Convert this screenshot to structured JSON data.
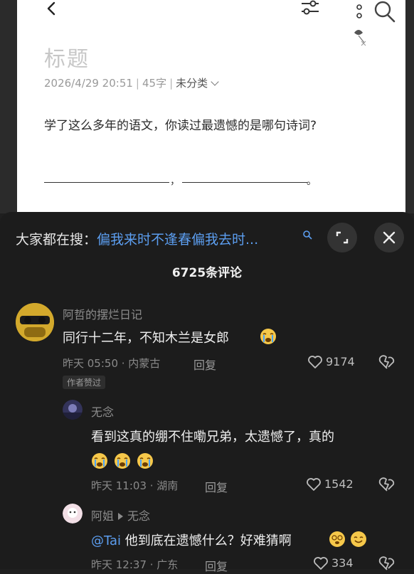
{
  "note": {
    "title": "标题",
    "date": "2026/4/29 20:51",
    "word_count": "45字",
    "category": "未分类",
    "question": "学了这么多年的语文，你读过最遗憾的是哪句诗词?",
    "comma": "，",
    "period": "。"
  },
  "comments_panel": {
    "search_label": "大家都在搜：",
    "search_query": "偏我来时不逢春偏我去时...",
    "count_text": "6725条评论"
  },
  "comments": [
    {
      "user": "阿哲的摆烂日记",
      "text": "同行十二年，不知木兰是女郎",
      "meta": "昨天 05:50 · 内蒙古",
      "reply": "回复",
      "likes": "9174",
      "badge": "作者赞过"
    },
    {
      "user": "无念",
      "text": "看到这真的绷不住嘞兄弟，太遗憾了，真的",
      "meta": "昨天 11:03 · 湖南",
      "reply": "回复",
      "likes": "1542"
    },
    {
      "user": "阿姐",
      "reply_to": "无念",
      "mention": "@Tai",
      "text": " 他到底在遗憾什么？好难猜啊",
      "meta": "昨天 12:37 · 广东",
      "reply": "回复",
      "likes": "334"
    }
  ],
  "icons": [
    "back-icon",
    "sliders-icon",
    "search-icon",
    "expand-icon",
    "close-icon",
    "heart-icon",
    "dislike-icon",
    "crying-emoji",
    "smile-emoji"
  ],
  "colors": {
    "accent": "#5c9ef0",
    "panel_bg": "#1c1c1c",
    "sheet_bg": "#ffffff"
  }
}
